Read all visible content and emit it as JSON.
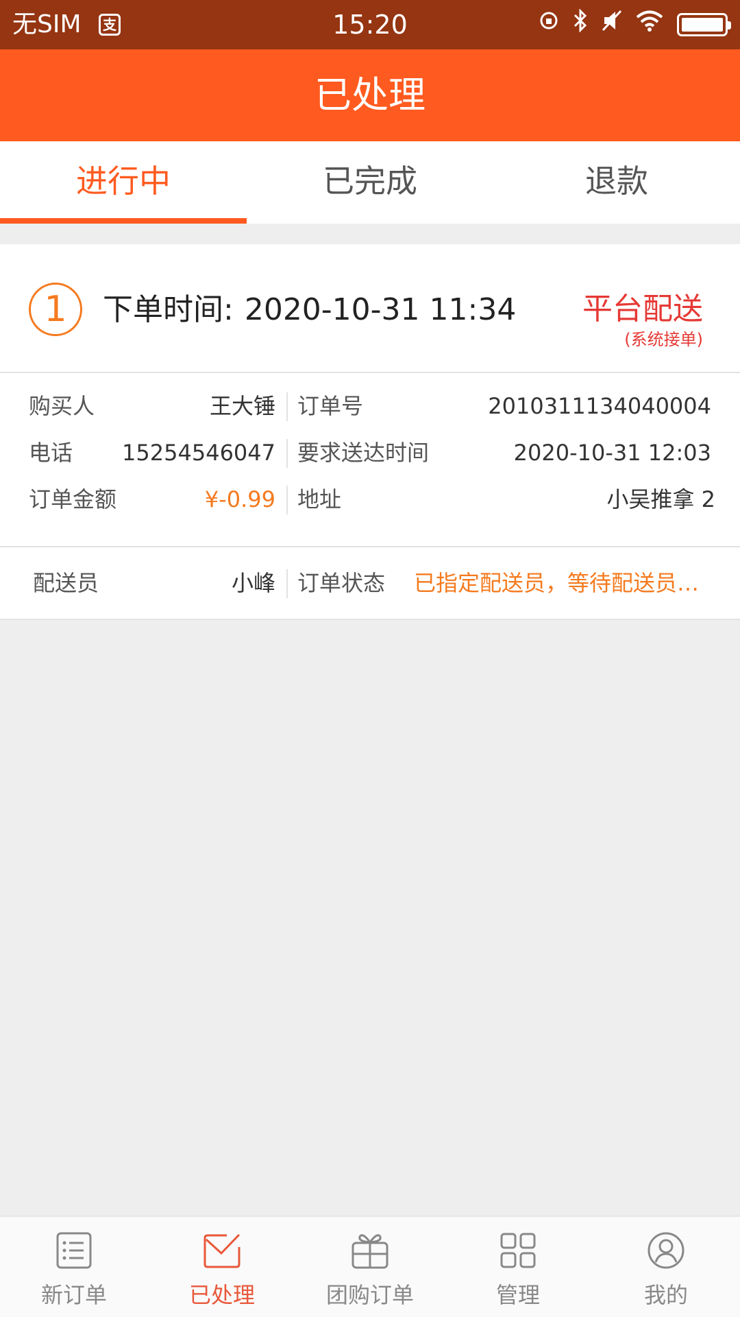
{
  "status_bar": {
    "carrier": "无SIM",
    "app_indicator": "支",
    "time": "15:20",
    "icons": [
      "rotation-lock-icon",
      "bluetooth-icon",
      "mute-icon",
      "wifi-icon",
      "battery-icon"
    ]
  },
  "header": {
    "title": "已处理"
  },
  "tabs": [
    {
      "label": "进行中",
      "active": true
    },
    {
      "label": "已完成",
      "active": false
    },
    {
      "label": "退款",
      "active": false
    }
  ],
  "order": {
    "index": "1",
    "time_label": "下单时间:",
    "time_value": "2020-10-31 11:34",
    "delivery_type": "平台配送",
    "delivery_sub": "(系统接单)",
    "buyer_label": "购买人",
    "buyer_value": "王大锤",
    "order_no_label": "订单号",
    "order_no_value": "2010311134040004",
    "phone_label": "电话",
    "phone_value": "15254546047",
    "deliver_time_label": "要求送达时间",
    "deliver_time_value": "2020-10-31 12:03",
    "amount_label": "订单金额",
    "amount_value": "¥-0.99",
    "address_label": "地址",
    "address_value": "小吴推拿 2",
    "courier_label": "配送员",
    "courier_value": "小峰",
    "status_label": "订单状态",
    "status_value": "已指定配送员，等待配送员…"
  },
  "colors": {
    "status_bar": "#953512",
    "accent": "#ff5a1f",
    "orange_text": "#f57a1e",
    "red_text": "#e53935",
    "nav_active": "#e8583a"
  },
  "bottom_nav": [
    {
      "label": "新订单",
      "icon": "list-icon",
      "active": false
    },
    {
      "label": "已处理",
      "icon": "mail-check-icon",
      "active": true
    },
    {
      "label": "团购订单",
      "icon": "gift-icon",
      "active": false
    },
    {
      "label": "管理",
      "icon": "grid-icon",
      "active": false
    },
    {
      "label": "我的",
      "icon": "user-icon",
      "active": false
    }
  ]
}
